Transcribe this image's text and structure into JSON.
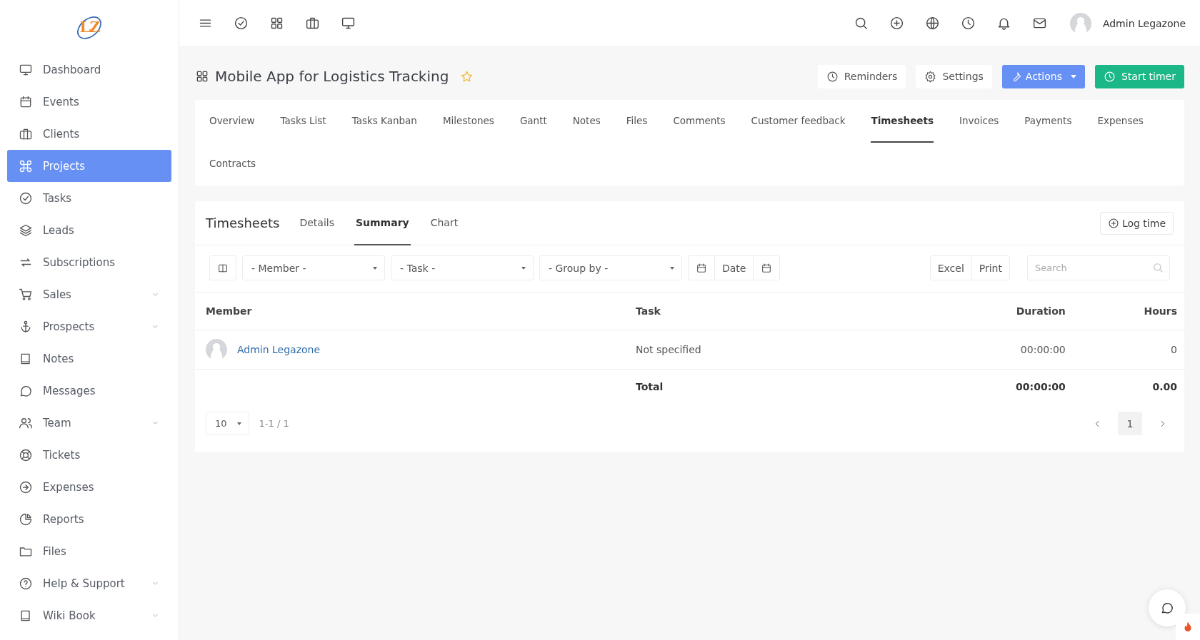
{
  "logo": {
    "text": "LZ"
  },
  "topbar": {
    "user": "Admin Legazone"
  },
  "sidebar": {
    "items": [
      {
        "label": "Dashboard",
        "selected": false,
        "expandable": false
      },
      {
        "label": "Events",
        "selected": false,
        "expandable": false
      },
      {
        "label": "Clients",
        "selected": false,
        "expandable": false
      },
      {
        "label": "Projects",
        "selected": true,
        "expandable": false
      },
      {
        "label": "Tasks",
        "selected": false,
        "expandable": false
      },
      {
        "label": "Leads",
        "selected": false,
        "expandable": false
      },
      {
        "label": "Subscriptions",
        "selected": false,
        "expandable": false
      },
      {
        "label": "Sales",
        "selected": false,
        "expandable": true
      },
      {
        "label": "Prospects",
        "selected": false,
        "expandable": true
      },
      {
        "label": "Notes",
        "selected": false,
        "expandable": false
      },
      {
        "label": "Messages",
        "selected": false,
        "expandable": false
      },
      {
        "label": "Team",
        "selected": false,
        "expandable": true
      },
      {
        "label": "Tickets",
        "selected": false,
        "expandable": false
      },
      {
        "label": "Expenses",
        "selected": false,
        "expandable": false
      },
      {
        "label": "Reports",
        "selected": false,
        "expandable": false
      },
      {
        "label": "Files",
        "selected": false,
        "expandable": false
      },
      {
        "label": "Help & Support",
        "selected": false,
        "expandable": true
      },
      {
        "label": "Wiki Book",
        "selected": false,
        "expandable": true
      }
    ]
  },
  "page": {
    "title": "Mobile App for Logistics Tracking",
    "starred": true,
    "buttons": [
      {
        "label": "Reminders",
        "kind": "plain"
      },
      {
        "label": "Settings",
        "kind": "plain"
      },
      {
        "label": "Actions",
        "kind": "dropdown"
      },
      {
        "label": "Start timer",
        "kind": "success"
      }
    ]
  },
  "tabs": [
    {
      "label": "Overview",
      "selected": false
    },
    {
      "label": "Tasks List",
      "selected": false
    },
    {
      "label": "Tasks Kanban",
      "selected": false
    },
    {
      "label": "Milestones",
      "selected": false
    },
    {
      "label": "Gantt",
      "selected": false
    },
    {
      "label": "Notes",
      "selected": false
    },
    {
      "label": "Files",
      "selected": false
    },
    {
      "label": "Comments",
      "selected": false
    },
    {
      "label": "Customer feedback",
      "selected": false
    },
    {
      "label": "Timesheets",
      "selected": true
    },
    {
      "label": "Invoices",
      "selected": false
    },
    {
      "label": "Payments",
      "selected": false
    },
    {
      "label": "Expenses",
      "selected": false
    },
    {
      "label": "Contracts",
      "selected": false
    }
  ],
  "panel": {
    "title": "Timesheets",
    "subtabs": [
      {
        "label": "Details",
        "selected": false
      },
      {
        "label": "Summary",
        "selected": true
      },
      {
        "label": "Chart",
        "selected": false
      }
    ],
    "log_button": "Log time",
    "filters": [
      "- Member -",
      "- Task -",
      "- Group by -"
    ],
    "date_label": "Date",
    "export_buttons": [
      "Excel",
      "Print"
    ],
    "search": {
      "placeholder": "Search"
    },
    "table": {
      "columns": [
        "Member",
        "Task",
        "Duration",
        "Hours"
      ],
      "rows": [
        {
          "member": "Admin Legazone",
          "task": "Not specified",
          "duration": "00:00:00",
          "hours": "0"
        }
      ],
      "total": {
        "label": "Total",
        "duration": "00:00:00",
        "hours": "0.00"
      }
    },
    "page_size": "10",
    "range": "1-1 / 1",
    "pages": [
      {
        "label": "1",
        "selected": true
      }
    ]
  }
}
